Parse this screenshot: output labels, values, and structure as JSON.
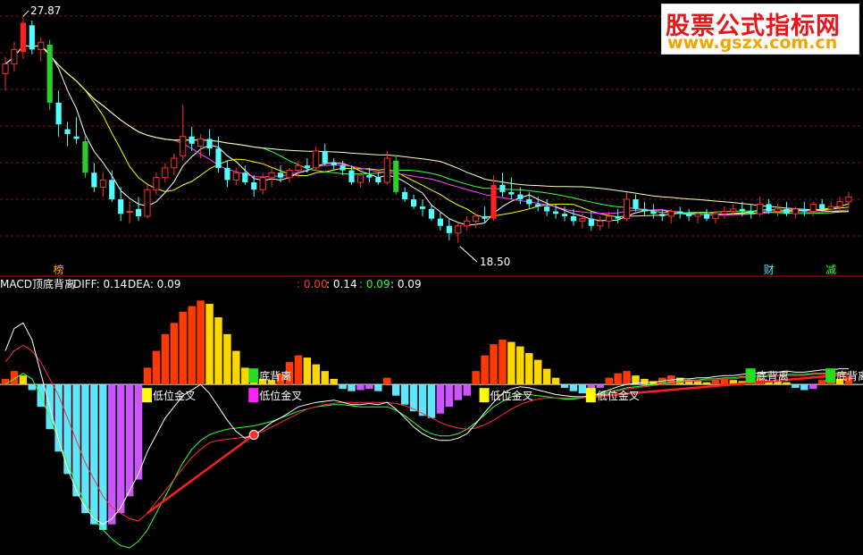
{
  "colors": {
    "background": "#000000",
    "panel_divider": "#8a0000",
    "grid": "#6e1a1a",
    "candle_up": "#ff3030",
    "candle_down": "#54ffff",
    "candle_up_big": "#ff2020",
    "candle_down_big": "#2ecc2e",
    "ma5": "#ffffff",
    "ma10": "#ffff00",
    "ma20": "#ff44ff",
    "ma60": "#44ff44",
    "ma120": "#ffffc0",
    "macd_pos_red": "#ff3a00",
    "macd_pos_yellow": "#ffd700",
    "macd_neg_cyan": "#5fe6ff",
    "macd_neg_magenta": "#cc55ff",
    "diff_line": "#ffffff",
    "dea_line": "#ff3030",
    "aux_line": "#33ff33",
    "watermark_title": "#e8161b",
    "watermark_url": "#f2a400"
  },
  "watermark": {
    "title": "股票公式指标网",
    "url": "www.gszx.com.cn"
  },
  "price_panel": {
    "high_label": "27.87",
    "low_label": "18.50",
    "bottom_tags": [
      {
        "text": "榜",
        "color": "#ffaa00",
        "bar_index": 6
      },
      {
        "text": "财",
        "color": "#5fe6ff",
        "bar_index": 86
      },
      {
        "text": "减",
        "color": "#33ff33",
        "bar_index": 93
      }
    ]
  },
  "indicator_panel": {
    "name": "MACD顶底背离",
    "diff_label": "DIFF: 0.14",
    "dea_label": "DEA: 0.09",
    "v1": ": 0.00",
    "v2": ": 0.14",
    "v3": ": 0.09",
    "v4": ": 0.09",
    "v1_color": "#ff3030",
    "v2_color": "#ffffff",
    "v3_color": "#33ff33",
    "v4_color": "#ffffff",
    "signals": [
      {
        "text": "低位金叉",
        "bar_index": 16,
        "box_color": "#ffff00"
      },
      {
        "text": "低位金叉",
        "bar_index": 28,
        "box_color": "#ff22ff"
      },
      {
        "text": "低位金叉",
        "bar_index": 54,
        "box_color": "#ffff00"
      },
      {
        "text": "低位金叉",
        "bar_index": 66,
        "box_color": "#ffff00"
      },
      {
        "text": "底背离",
        "bar_index": 28,
        "box_color": "#22dd22"
      },
      {
        "text": "底背离",
        "bar_index": 84,
        "box_color": "#22dd22"
      },
      {
        "text": "底背离",
        "bar_index": 93,
        "box_color": "#22dd22"
      }
    ]
  },
  "chart_data": {
    "type": "candlestick",
    "price_range": [
      17.6,
      28.4
    ],
    "candles": [
      [
        25.5,
        26.2,
        24.8,
        25.9
      ],
      [
        25.9,
        26.8,
        25.6,
        26.5
      ],
      [
        26.4,
        27.87,
        26.1,
        27.6
      ],
      [
        27.5,
        27.7,
        26.3,
        26.5
      ],
      [
        26.5,
        27.0,
        26.0,
        26.8
      ],
      [
        26.7,
        26.9,
        24.0,
        24.3
      ],
      [
        24.3,
        24.8,
        22.9,
        23.4
      ],
      [
        23.2,
        23.5,
        22.5,
        23.0
      ],
      [
        22.9,
        23.7,
        22.6,
        22.8
      ],
      [
        22.7,
        22.9,
        21.2,
        21.4
      ],
      [
        21.4,
        21.8,
        20.6,
        20.8
      ],
      [
        20.8,
        21.4,
        20.4,
        21.1
      ],
      [
        21.1,
        21.5,
        20.2,
        20.3
      ],
      [
        20.3,
        20.8,
        19.4,
        19.7
      ],
      [
        19.8,
        20.2,
        19.3,
        19.8
      ],
      [
        19.9,
        20.4,
        19.4,
        19.6
      ],
      [
        19.6,
        20.9,
        19.5,
        20.7
      ],
      [
        20.7,
        21.4,
        20.5,
        21.2
      ],
      [
        21.2,
        21.8,
        21.0,
        21.6
      ],
      [
        21.6,
        22.2,
        21.3,
        22.0
      ],
      [
        22.1,
        24.2,
        21.9,
        22.9
      ],
      [
        22.9,
        23.3,
        22.3,
        22.6
      ],
      [
        22.5,
        23.0,
        22.0,
        22.8
      ],
      [
        22.8,
        23.2,
        22.1,
        22.4
      ],
      [
        22.4,
        22.9,
        21.4,
        21.6
      ],
      [
        21.6,
        21.9,
        20.8,
        21.1
      ],
      [
        21.1,
        21.6,
        20.9,
        21.4
      ],
      [
        21.4,
        21.7,
        20.9,
        21.0
      ],
      [
        21.0,
        21.3,
        20.4,
        20.7
      ],
      [
        20.7,
        21.4,
        20.5,
        21.2
      ],
      [
        21.2,
        21.6,
        20.8,
        21.4
      ],
      [
        21.4,
        21.7,
        21.0,
        21.2
      ],
      [
        21.2,
        21.6,
        21.0,
        21.5
      ],
      [
        21.5,
        21.9,
        21.2,
        21.7
      ],
      [
        21.7,
        22.0,
        21.4,
        21.6
      ],
      [
        21.6,
        22.5,
        21.5,
        22.3
      ],
      [
        22.3,
        22.6,
        21.7,
        21.8
      ],
      [
        21.8,
        22.0,
        21.5,
        21.7
      ],
      [
        21.7,
        21.9,
        21.3,
        21.5
      ],
      [
        21.5,
        21.7,
        20.9,
        21.0
      ],
      [
        21.0,
        21.4,
        20.8,
        21.3
      ],
      [
        21.3,
        21.6,
        21.0,
        21.2
      ],
      [
        21.2,
        21.4,
        20.9,
        21.0
      ],
      [
        21.0,
        22.3,
        20.9,
        22.0
      ],
      [
        21.9,
        22.1,
        20.5,
        20.6
      ],
      [
        20.6,
        20.8,
        20.2,
        20.3
      ],
      [
        20.3,
        20.5,
        19.9,
        20.0
      ],
      [
        20.0,
        20.3,
        19.6,
        19.9
      ],
      [
        19.9,
        20.1,
        19.4,
        19.5
      ],
      [
        19.5,
        19.8,
        19.0,
        19.2
      ],
      [
        19.2,
        19.5,
        18.6,
        18.9
      ],
      [
        18.9,
        19.3,
        18.5,
        19.2
      ],
      [
        19.2,
        19.6,
        19.0,
        19.4
      ],
      [
        19.4,
        19.7,
        19.1,
        19.6
      ],
      [
        19.6,
        20.0,
        19.3,
        19.5
      ],
      [
        19.5,
        21.3,
        19.4,
        20.9
      ],
      [
        20.9,
        21.4,
        20.4,
        20.6
      ],
      [
        20.6,
        21.2,
        20.3,
        20.5
      ],
      [
        20.5,
        20.8,
        20.1,
        20.3
      ],
      [
        20.3,
        20.6,
        19.9,
        20.1
      ],
      [
        20.1,
        20.4,
        19.8,
        20.0
      ],
      [
        20.0,
        20.3,
        19.6,
        19.8
      ],
      [
        19.8,
        20.1,
        19.5,
        19.7
      ],
      [
        19.7,
        20.0,
        19.4,
        19.6
      ],
      [
        19.6,
        19.9,
        19.2,
        19.4
      ],
      [
        19.4,
        19.7,
        19.1,
        19.5
      ],
      [
        19.5,
        19.8,
        19.0,
        19.2
      ],
      [
        19.2,
        19.6,
        19.0,
        19.4
      ],
      [
        19.4,
        19.8,
        19.1,
        19.6
      ],
      [
        19.6,
        19.9,
        19.3,
        19.5
      ],
      [
        19.5,
        20.6,
        19.4,
        20.3
      ],
      [
        20.3,
        20.5,
        19.8,
        19.9
      ],
      [
        19.9,
        20.2,
        19.6,
        19.8
      ],
      [
        19.8,
        20.1,
        19.5,
        19.7
      ],
      [
        19.7,
        19.9,
        19.4,
        19.6
      ],
      [
        19.6,
        19.9,
        19.3,
        19.8
      ],
      [
        19.8,
        20.0,
        19.5,
        19.7
      ],
      [
        19.7,
        19.9,
        19.4,
        19.6
      ],
      [
        19.6,
        19.8,
        19.3,
        19.7
      ],
      [
        19.7,
        19.9,
        19.4,
        19.5
      ],
      [
        19.5,
        19.8,
        19.3,
        19.7
      ],
      [
        19.7,
        20.0,
        19.5,
        19.8
      ],
      [
        19.8,
        20.1,
        19.6,
        19.9
      ],
      [
        19.9,
        20.2,
        19.6,
        19.8
      ],
      [
        19.8,
        20.1,
        19.5,
        19.7
      ],
      [
        19.7,
        20.4,
        19.6,
        20.1
      ],
      [
        20.1,
        20.3,
        19.7,
        19.8
      ],
      [
        19.8,
        20.1,
        19.6,
        19.9
      ],
      [
        19.9,
        20.2,
        19.6,
        19.7
      ],
      [
        19.7,
        20.0,
        19.5,
        19.9
      ],
      [
        19.9,
        20.2,
        19.6,
        19.8
      ],
      [
        19.8,
        20.2,
        19.6,
        20.1
      ],
      [
        20.1,
        20.3,
        19.8,
        19.9
      ],
      [
        19.9,
        20.2,
        19.7,
        20.0
      ],
      [
        20.0,
        20.4,
        19.8,
        20.2
      ],
      [
        20.2,
        20.6,
        20.0,
        20.4
      ]
    ],
    "macd_range": [
      -1.5,
      0.8
    ],
    "macd_hist": [
      0.05,
      0.12,
      0.08,
      -0.05,
      -0.2,
      -0.4,
      -0.6,
      -0.8,
      -1.0,
      -1.15,
      -1.25,
      -1.3,
      -1.25,
      -1.15,
      -1.0,
      -0.85,
      0.15,
      0.3,
      0.45,
      0.55,
      0.65,
      0.7,
      0.75,
      0.72,
      0.6,
      0.45,
      0.3,
      0.15,
      0.06,
      0.05,
      0.04,
      0.1,
      0.2,
      0.26,
      0.24,
      0.18,
      0.12,
      0.05,
      -0.04,
      -0.06,
      -0.05,
      -0.04,
      -0.06,
      0.06,
      -0.1,
      -0.18,
      -0.24,
      -0.28,
      -0.3,
      -0.26,
      -0.2,
      -0.14,
      -0.1,
      0.12,
      0.26,
      0.36,
      0.4,
      0.38,
      0.34,
      0.28,
      0.22,
      0.14,
      0.06,
      -0.03,
      -0.06,
      -0.08,
      -0.05,
      -0.03,
      0.06,
      0.1,
      0.12,
      0.08,
      0.05,
      0.03,
      0.06,
      0.08,
      0.06,
      0.04,
      0.03,
      0.02,
      0.04,
      0.05,
      0.04,
      0.03,
      0.05,
      0.06,
      0.04,
      0.03,
      0.02,
      -0.03,
      -0.05,
      -0.04,
      0.04,
      0.06,
      0.05,
      0.07
    ],
    "diff": [
      0.3,
      0.5,
      0.55,
      0.4,
      0.1,
      -0.2,
      -0.5,
      -0.75,
      -0.95,
      -1.1,
      -1.2,
      -1.25,
      -1.2,
      -1.1,
      -0.95,
      -0.8,
      -0.6,
      -0.45,
      -0.3,
      -0.2,
      -0.1,
      -0.05,
      0.0,
      -0.08,
      -0.2,
      -0.32,
      -0.42,
      -0.48,
      -0.45,
      -0.4,
      -0.34,
      -0.3,
      -0.25,
      -0.2,
      -0.18,
      -0.16,
      -0.15,
      -0.14,
      -0.16,
      -0.18,
      -0.18,
      -0.17,
      -0.18,
      -0.16,
      -0.22,
      -0.3,
      -0.38,
      -0.44,
      -0.48,
      -0.5,
      -0.5,
      -0.48,
      -0.44,
      -0.35,
      -0.25,
      -0.16,
      -0.08,
      -0.04,
      -0.02,
      -0.03,
      -0.05,
      -0.07,
      -0.09,
      -0.1,
      -0.11,
      -0.11,
      -0.1,
      -0.08,
      -0.05,
      -0.02,
      0.0,
      0.01,
      0.02,
      0.02,
      0.03,
      0.04,
      0.05,
      0.05,
      0.06,
      0.06,
      0.07,
      0.08,
      0.08,
      0.09,
      0.1,
      0.1,
      0.11,
      0.11,
      0.12,
      0.11,
      0.11,
      0.12,
      0.13,
      0.13,
      0.14,
      0.14
    ],
    "dea": [
      0.2,
      0.3,
      0.35,
      0.3,
      0.2,
      0.05,
      -0.1,
      -0.3,
      -0.5,
      -0.7,
      -0.85,
      -1.0,
      -1.1,
      -1.15,
      -1.2,
      -1.22,
      -1.15,
      -1.05,
      -0.95,
      -0.85,
      -0.75,
      -0.65,
      -0.58,
      -0.52,
      -0.5,
      -0.49,
      -0.48,
      -0.47,
      -0.45,
      -0.42,
      -0.38,
      -0.34,
      -0.3,
      -0.26,
      -0.22,
      -0.2,
      -0.18,
      -0.17,
      -0.16,
      -0.16,
      -0.16,
      -0.16,
      -0.16,
      -0.16,
      -0.17,
      -0.19,
      -0.22,
      -0.26,
      -0.3,
      -0.34,
      -0.37,
      -0.39,
      -0.4,
      -0.39,
      -0.36,
      -0.32,
      -0.27,
      -0.22,
      -0.18,
      -0.15,
      -0.13,
      -0.12,
      -0.12,
      -0.12,
      -0.12,
      -0.12,
      -0.11,
      -0.1,
      -0.08,
      -0.06,
      -0.04,
      -0.03,
      -0.02,
      -0.01,
      0.0,
      0.01,
      0.02,
      0.03,
      0.03,
      0.04,
      0.04,
      0.05,
      0.05,
      0.06,
      0.06,
      0.07,
      0.07,
      0.08,
      0.08,
      0.08,
      0.08,
      0.09,
      0.09,
      0.09,
      0.09,
      0.09
    ],
    "aux": [
      0.0,
      0.05,
      0.1,
      0.05,
      -0.1,
      -0.3,
      -0.5,
      -0.7,
      -0.9,
      -1.05,
      -1.2,
      -1.3,
      -1.38,
      -1.44,
      -1.46,
      -1.4,
      -1.3,
      -1.15,
      -1.0,
      -0.85,
      -0.7,
      -0.58,
      -0.5,
      -0.45,
      -0.42,
      -0.4,
      -0.39,
      -0.38,
      -0.37,
      -0.35,
      -0.33,
      -0.3,
      -0.27,
      -0.24,
      -0.22,
      -0.2,
      -0.19,
      -0.18,
      -0.18,
      -0.19,
      -0.2,
      -0.2,
      -0.2,
      -0.2,
      -0.23,
      -0.28,
      -0.34,
      -0.4,
      -0.44,
      -0.46,
      -0.46,
      -0.44,
      -0.4,
      -0.34,
      -0.27,
      -0.2,
      -0.15,
      -0.11,
      -0.09,
      -0.09,
      -0.1,
      -0.11,
      -0.12,
      -0.13,
      -0.13,
      -0.12,
      -0.11,
      -0.09,
      -0.07,
      -0.05,
      -0.03,
      -0.02,
      -0.01,
      0.0,
      0.01,
      0.02,
      0.03,
      0.04,
      0.04,
      0.05,
      0.05,
      0.06,
      0.06,
      0.07,
      0.07,
      0.08,
      0.08,
      0.08,
      0.09,
      0.09,
      0.09,
      0.1,
      0.1,
      0.1,
      0.1,
      0.1
    ],
    "divergence_segments": [
      {
        "from_index": 16,
        "to_index": 28
      },
      {
        "from_index": 66,
        "to_index": 95
      }
    ]
  }
}
